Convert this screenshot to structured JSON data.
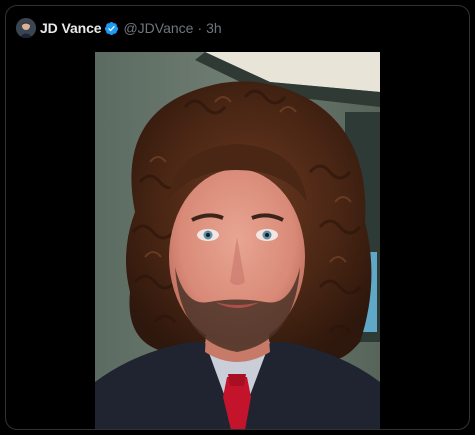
{
  "tweet": {
    "author_name": "JD Vance",
    "handle": "@JDVance",
    "separator": "·",
    "time": "3h",
    "verified": true,
    "verified_color": "#1d9bf0"
  },
  "media": {
    "kind": "photo",
    "subject": "selfie-curly-wig"
  }
}
